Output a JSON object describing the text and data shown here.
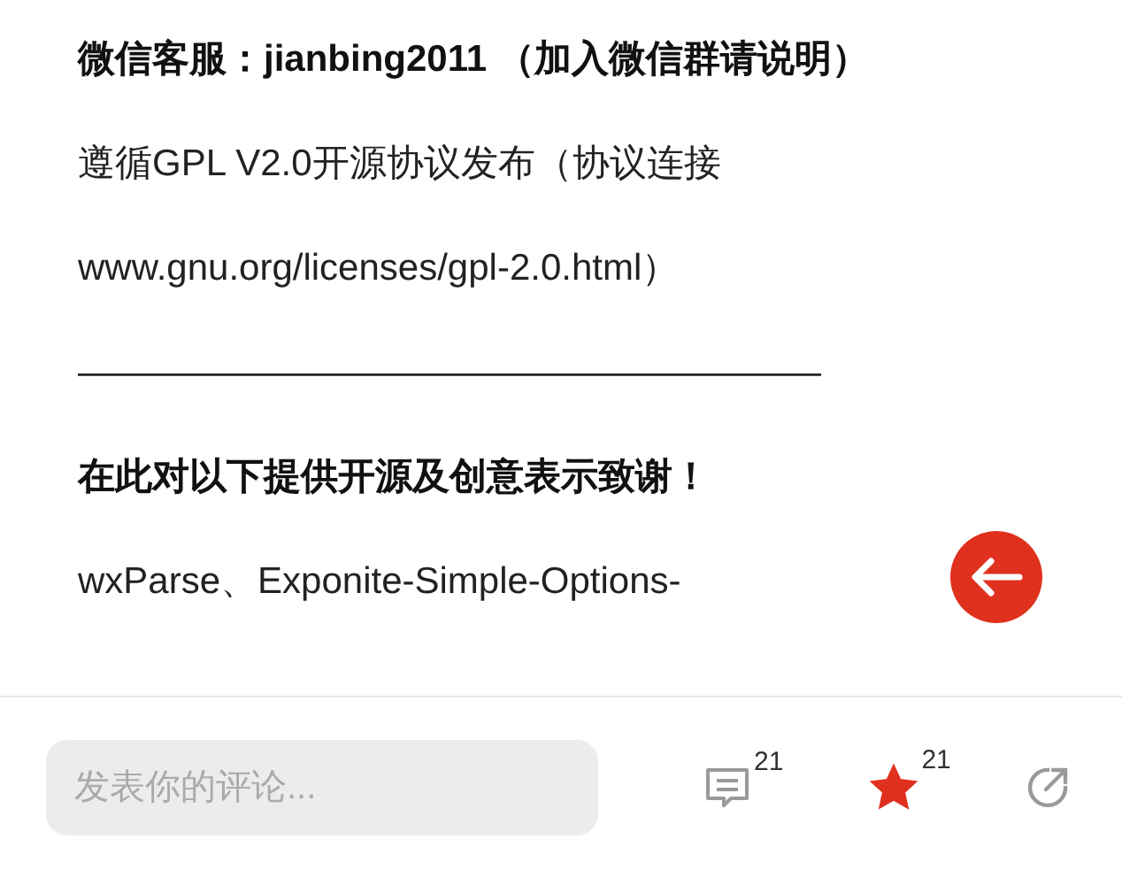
{
  "article": {
    "paragraphs": [
      {
        "text": "微信客服：jianbing2011 （加入微信群请说明）",
        "bold": true
      },
      {
        "text": "遵循GPL V2.0开源协议发布（协议连接 www.gnu.org/licenses/gpl-2.0.html）",
        "bold": false
      },
      {
        "text": "————————————————————",
        "bold": false
      },
      {
        "text": "在此对以下提供开源及创意表示致谢！",
        "bold": true
      },
      {
        "text": "wxParse、Exponite-Simple-Options-",
        "bold": false
      }
    ]
  },
  "bottom_bar": {
    "comment_field": {
      "placeholder": "发表你的评论..."
    },
    "comment_count": "21",
    "like_count": "21",
    "liked": true
  }
}
